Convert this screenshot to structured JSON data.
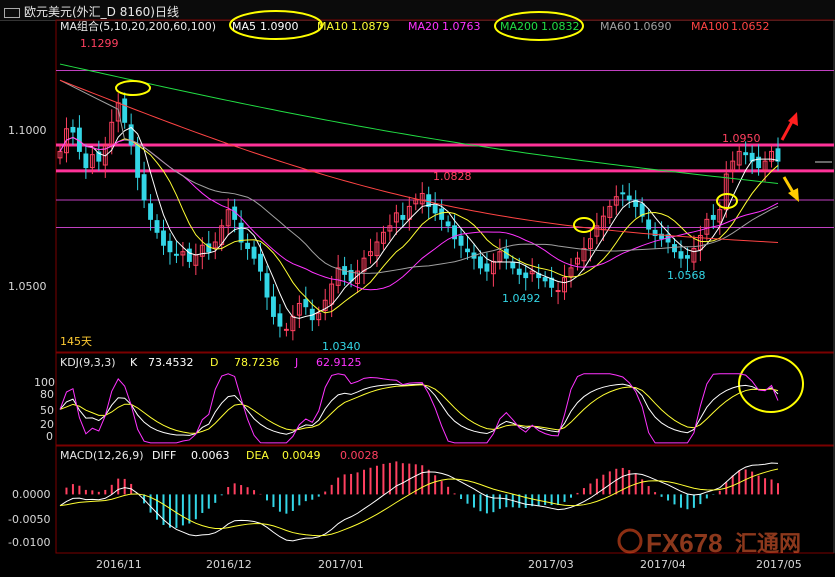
{
  "window": {
    "title": "欧元美元(外汇_D 8160)日线"
  },
  "colors": {
    "background": "#000000",
    "up": "#ff4060",
    "down": "#33d6e6",
    "ma5": "#ffffff",
    "ma10": "#ffff33",
    "ma20": "#ff33ff",
    "ma200": "#22dd44",
    "ma60": "#a0a0a0",
    "ma100": "#ff4444",
    "level_line": "#ff3399",
    "ref_line": "#c040c0",
    "annotation_circle": "#ffff00",
    "arrow_up": "#ff2020",
    "arrow_down": "#ffcc00"
  },
  "chart_data": [
    {
      "type": "candlestick",
      "title": "欧元美元(外汇_D 8160)日线",
      "ma_legend": {
        "label": "MA组合(5,10,20,200,60,100)",
        "items": [
          {
            "name": "MA5",
            "value": "1.0900",
            "color": "#ffffff",
            "circled": true
          },
          {
            "name": "MA10",
            "value": "1.0879",
            "color": "#ffff33"
          },
          {
            "name": "MA20",
            "value": "1.0763",
            "color": "#ff33ff"
          },
          {
            "name": "MA200",
            "value": "1.0832",
            "color": "#22dd44",
            "circled": true
          },
          {
            "name": "MA60",
            "value": "1.0690",
            "color": "#a0a0a0"
          },
          {
            "name": "MA100",
            "value": "1.0652",
            "color": "#ff4444"
          }
        ]
      },
      "y_ticks": [
        "1.1000",
        "1.0500"
      ],
      "ylim": [
        1.031,
        1.133
      ],
      "period_label": "145天",
      "price_labels": [
        {
          "label": "1.1299",
          "value": 1.1299,
          "date": "2016-11-09",
          "color": "#ff4060"
        },
        {
          "label": "1.0340",
          "value": 1.034,
          "date": "2017-01-03",
          "color": "#33d6e6"
        },
        {
          "label": "1.0828",
          "value": 1.0828,
          "date": "2017-02-02",
          "color": "#ff4060"
        },
        {
          "label": "1.0492",
          "value": 1.0492,
          "date": "2017-02-22",
          "color": "#33d6e6"
        },
        {
          "label": "1.0568",
          "value": 1.0568,
          "date": "2017-04-10",
          "color": "#33d6e6"
        },
        {
          "label": "1.0950",
          "value": 1.095,
          "date": "2017-05-08",
          "color": "#ff4060"
        }
      ],
      "horizontal_levels": [
        {
          "value": 1.095,
          "style": "thick",
          "color": "#ff3399"
        },
        {
          "value": 1.087,
          "style": "thick",
          "color": "#ff3399"
        },
        {
          "value": 1.118,
          "style": "thin",
          "color": "#c040c0"
        },
        {
          "value": 1.078,
          "style": "thin",
          "color": "#c040c0"
        },
        {
          "value": 1.0695,
          "style": "thin",
          "color": "#c040c0"
        }
      ],
      "closes": [
        1.093,
        1.1,
        1.099,
        1.093,
        1.088,
        1.092,
        1.09,
        1.095,
        1.102,
        1.108,
        1.102,
        1.095,
        1.085,
        1.078,
        1.072,
        1.068,
        1.064,
        1.062,
        1.061,
        1.062,
        1.059,
        1.061,
        1.064,
        1.062,
        1.065,
        1.07,
        1.075,
        1.072,
        1.065,
        1.063,
        1.06,
        1.056,
        1.048,
        1.042,
        1.039,
        1.038,
        1.042,
        1.046,
        1.045,
        1.041,
        1.043,
        1.047,
        1.052,
        1.057,
        1.055,
        1.053,
        1.056,
        1.06,
        1.062,
        1.065,
        1.068,
        1.07,
        1.074,
        1.072,
        1.076,
        1.078,
        1.08,
        1.076,
        1.074,
        1.072,
        1.07,
        1.066,
        1.064,
        1.062,
        1.06,
        1.057,
        1.056,
        1.059,
        1.062,
        1.06,
        1.057,
        1.055,
        1.054,
        1.056,
        1.054,
        1.053,
        1.051,
        1.05,
        1.054,
        1.057,
        1.06,
        1.063,
        1.066,
        1.07,
        1.073,
        1.076,
        1.079,
        1.08,
        1.078,
        1.076,
        1.073,
        1.069,
        1.067,
        1.066,
        1.065,
        1.062,
        1.06,
        1.06,
        1.063,
        1.067,
        1.072,
        1.072,
        1.075,
        1.086,
        1.09,
        1.093,
        1.092,
        1.09,
        1.088,
        1.09,
        1.093,
        1.09
      ],
      "dates_axis": [
        "2016/11",
        "2016/12",
        "2017/01",
        "2017/03",
        "2017/04",
        "2017/05"
      ]
    },
    {
      "type": "line",
      "title": "KDJ(9,3,3)",
      "series": [
        {
          "name": "K",
          "value": "73.4532",
          "color": "#ffffff"
        },
        {
          "name": "D",
          "value": "78.7236",
          "color": "#ffff33"
        },
        {
          "name": "J",
          "value": "62.9125",
          "color": "#ff33ff"
        }
      ],
      "y_ticks": [
        100,
        80,
        50,
        20,
        0
      ],
      "ylim": [
        -10,
        115
      ]
    },
    {
      "type": "bar",
      "title": "MACD(12,26,9)",
      "series": [
        {
          "name": "DIFF",
          "value": "0.0063",
          "color": "#ffffff"
        },
        {
          "name": "DEA",
          "value": "0.0049",
          "color": "#ffff33"
        },
        {
          "name": "MACD",
          "value": "0.0028",
          "color": "#ff4060"
        }
      ],
      "y_ticks": [
        "0.0000",
        "-0.0050",
        "-0.0100"
      ],
      "ylim": [
        -0.0128,
        0.0072
      ]
    }
  ],
  "watermark": {
    "text": "FX678",
    "sub": "汇通网"
  }
}
